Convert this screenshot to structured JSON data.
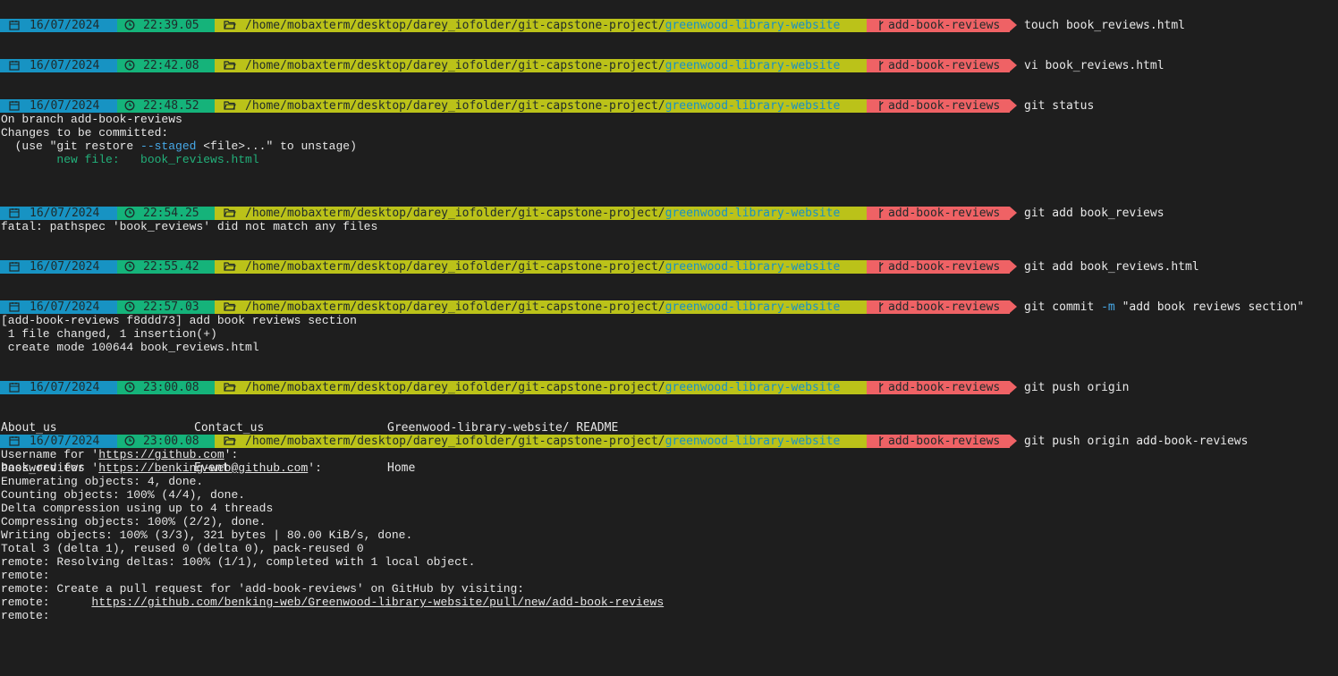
{
  "session": {
    "path_prefix": "/home/mobaxterm/desktop/darey_iofolder/git-capstone-project/",
    "path_highlight": "greenwood-library-website",
    "branch": "add-book-reviews"
  },
  "colors": {
    "background": "#1e1e1e",
    "date_segment": "#1793c3",
    "time_segment": "#15b37a",
    "path_segment": "#bbc219",
    "branch_segment": "#ef6265",
    "path_highlight": "#1790c6",
    "flag_text": "#47a9e8",
    "new_file_text": "#22b07a"
  },
  "icons": {
    "date": "calendar-icon",
    "time": "clock-icon",
    "path": "folder-open-icon",
    "branch": "git-branch-icon"
  },
  "prompts": [
    {
      "date": "16/07/2024",
      "time": "22:39.05",
      "command": "touch book_reviews.html"
    },
    {
      "date": "16/07/2024",
      "time": "22:42.08",
      "command": "vi book_reviews.html"
    },
    {
      "date": "16/07/2024",
      "time": "22:48.52",
      "command": "git status"
    },
    {
      "date": "16/07/2024",
      "time": "22:54.25",
      "command": "git add book_reviews"
    },
    {
      "date": "16/07/2024",
      "time": "22:55.42",
      "command": "git add book_reviews.html"
    },
    {
      "date": "16/07/2024",
      "time": "22:57.03",
      "command_parts": [
        "git commit ",
        "-m",
        " \"add book reviews section\""
      ]
    },
    {
      "date": "16/07/2024",
      "time": "23:00.08",
      "command": "git push origin"
    },
    {
      "date": "16/07/2024",
      "time": "23:00.08",
      "command": "git push origin add-book-reviews"
    }
  ],
  "outputs": {
    "git_status": {
      "line1": "On branch add-book-reviews",
      "line2": "Changes to be committed:",
      "line3_a": "  (use \"git restore ",
      "line3_flag": "--staged",
      "line3_b": " <file>...\" to unstage)",
      "line4": "        new file:   book_reviews.html"
    },
    "git_add_error": "fatal: pathspec 'book_reviews' did not match any files",
    "git_commit": [
      "[add-book-reviews f8ddd73] add book reviews section",
      " 1 file changed, 1 insertion(+)",
      " create mode 100644 book_reviews.html"
    ],
    "completions": {
      "row1": [
        "About_us",
        "Contact_us",
        "Greenwood-library-website/ README"
      ],
      "row2": [
        "book_reviews",
        "Event",
        "Home"
      ]
    },
    "git_push": {
      "username_pre": "Username for '",
      "username_url": "https://github.com",
      "username_post": "':",
      "password_pre": "Password for '",
      "password_url": "https://benking-web@github.com",
      "password_post": "':",
      "lines": [
        "Enumerating objects: 4, done.",
        "Counting objects: 100% (4/4), done.",
        "Delta compression using up to 4 threads",
        "Compressing objects: 100% (2/2), done.",
        "Writing objects: 100% (3/3), 321 bytes | 80.00 KiB/s, done.",
        "Total 3 (delta 1), reused 0 (delta 0), pack-reused 0",
        "remote: Resolving deltas: 100% (1/1), completed with 1 local object.",
        "remote:",
        "remote: Create a pull request for 'add-book-reviews' on GitHub by visiting:"
      ],
      "pr_prefix": "remote:      ",
      "pr_url": "https://github.com/benking-web/Greenwood-library-website/pull/new/add-book-reviews",
      "last": "remote:"
    }
  }
}
